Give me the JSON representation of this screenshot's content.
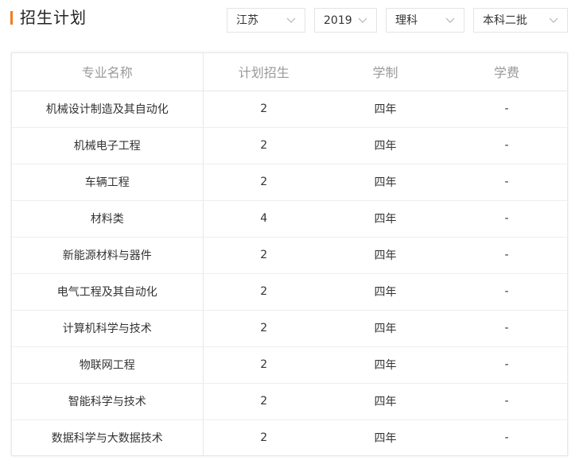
{
  "header": {
    "title": "招生计划"
  },
  "filters": {
    "province": "江苏",
    "year": "2019",
    "subject_type": "理科",
    "batch": "本科二批"
  },
  "table": {
    "columns": [
      "专业名称",
      "计划招生",
      "学制",
      "学费"
    ],
    "rows": [
      {
        "major": "机械设计制造及其自动化",
        "plan": "2",
        "duration": "四年",
        "fee": "-"
      },
      {
        "major": "机械电子工程",
        "plan": "2",
        "duration": "四年",
        "fee": "-"
      },
      {
        "major": "车辆工程",
        "plan": "2",
        "duration": "四年",
        "fee": "-"
      },
      {
        "major": "材料类",
        "plan": "4",
        "duration": "四年",
        "fee": "-"
      },
      {
        "major": "新能源材料与器件",
        "plan": "2",
        "duration": "四年",
        "fee": "-"
      },
      {
        "major": "电气工程及其自动化",
        "plan": "2",
        "duration": "四年",
        "fee": "-"
      },
      {
        "major": "计算机科学与技术",
        "plan": "2",
        "duration": "四年",
        "fee": "-"
      },
      {
        "major": "物联网工程",
        "plan": "2",
        "duration": "四年",
        "fee": "-"
      },
      {
        "major": "智能科学与技术",
        "plan": "2",
        "duration": "四年",
        "fee": "-"
      },
      {
        "major": "数据科学与大数据技术",
        "plan": "2",
        "duration": "四年",
        "fee": "-"
      }
    ]
  },
  "colors": {
    "accent": "#f07c1f",
    "header_text": "#9a9a9a",
    "border": "#e6e6e6"
  },
  "icons": {
    "dropdown": "chevron-down-icon"
  }
}
